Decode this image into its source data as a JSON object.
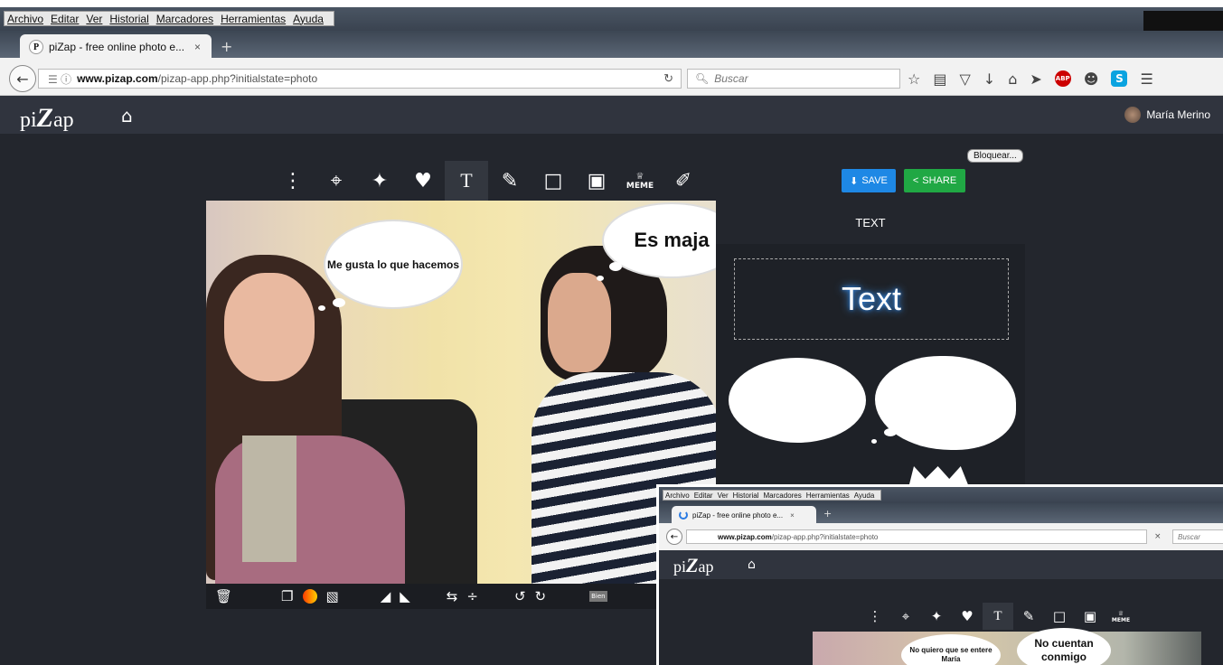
{
  "browser": {
    "menu": [
      "Archivo",
      "Editar",
      "Ver",
      "Historial",
      "Marcadores",
      "Herramientas",
      "Ayuda"
    ],
    "tab_title": "piZap - free online photo e...",
    "tab_close": "×",
    "new_tab": "+",
    "url_domain": "www.pizap.com",
    "url_path": "/pizap-app.php?initialstate=photo",
    "search_placeholder": "Buscar"
  },
  "app": {
    "logo_pi": "pi",
    "logo_z": "Z",
    "logo_ap": "ap",
    "user_name": "María Merino",
    "bloquear": "Bloquear...",
    "save_label": "SAVE",
    "share_label": "SHARE",
    "meme_label": "MEME",
    "text_tool": "T",
    "panel_title": "TEXT",
    "panel_text_sample": "Text",
    "bubble1": "Me gusta lo que hacemos",
    "bubble2": "Es maja",
    "bottom_tail": "Bien"
  },
  "inset": {
    "menu": [
      "Archivo",
      "Editar",
      "Ver",
      "Historial",
      "Marcadores",
      "Herramientas",
      "Ayuda"
    ],
    "tab_title": "piZap - free online photo e...",
    "tab_close": "×",
    "new_tab": "+",
    "url_domain": "www.pizap.com",
    "url_path": "/pizap-app.php?initialstate=photo",
    "search_placeholder": "Buscar",
    "clear": "×",
    "bubble1": "No quiero que se entere María",
    "bubble2": "No cuentan conmigo"
  }
}
